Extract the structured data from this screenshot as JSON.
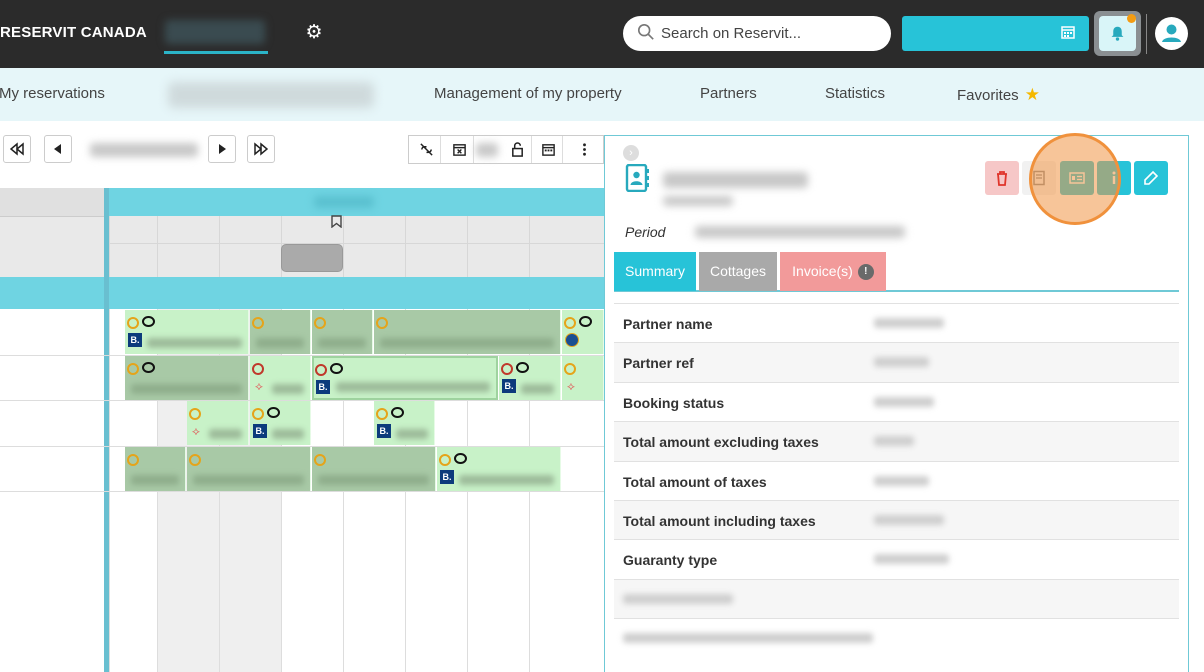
{
  "header": {
    "brand": "RESERVIT CANADA",
    "search_placeholder": "Search on Reservit..."
  },
  "nav": {
    "items": [
      {
        "label": "My reservations"
      },
      {
        "label": "Management of my property"
      },
      {
        "label": "Partners"
      },
      {
        "label": "Statistics"
      },
      {
        "label": "Favorites"
      }
    ]
  },
  "panel": {
    "period_label": "Period",
    "tabs": [
      {
        "label": "Summary",
        "active": true
      },
      {
        "label": "Cottages",
        "active": false
      },
      {
        "label": "Invoice(s)",
        "active": false
      }
    ],
    "invoice_alert": "!",
    "rows": [
      {
        "label": "Partner name"
      },
      {
        "label": "Partner ref"
      },
      {
        "label": "Booking status"
      },
      {
        "label": "Total amount excluding taxes"
      },
      {
        "label": "Total amount of taxes"
      },
      {
        "label": "Total amount including taxes"
      },
      {
        "label": "Guaranty type"
      },
      {
        "label": ""
      },
      {
        "label": ""
      }
    ]
  },
  "colors": {
    "accent": "#27c3d8",
    "topbar": "#2b2b2b",
    "navbar": "#e6f6f9",
    "booking_green": "#c8f2c8",
    "booking_dark": "#a8c9a6",
    "tab_summary": "#27c3d8",
    "tab_cottages": "#a9a9a9",
    "tab_invoice": "#f29a9a",
    "delete_bg": "#f6c7c7",
    "highlight": "#f0913c"
  },
  "icons": {
    "settings": "gear-icon",
    "search": "search-icon",
    "calendar": "calendar-icon",
    "notifications": "bell-icon",
    "user": "user-icon",
    "delete": "trash-icon",
    "book": "book-icon",
    "card": "id-card-icon",
    "info": "info-icon",
    "edit": "edit-icon",
    "contact": "address-book-icon"
  }
}
